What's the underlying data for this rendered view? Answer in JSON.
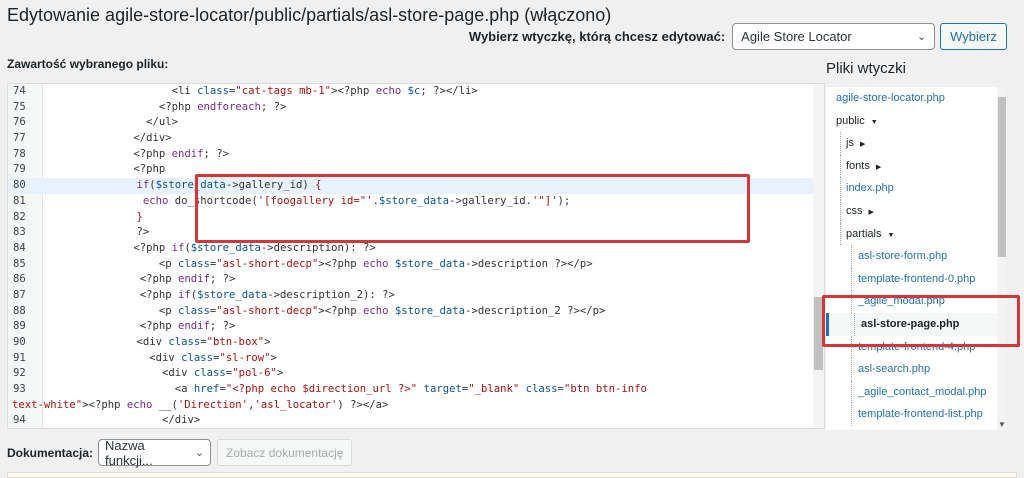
{
  "page": {
    "title": "Edytowanie agile-store-locator/public/partials/asl-store-page.php (włączono)",
    "content_label": "Zawartość wybranego pliku:"
  },
  "plugin_picker": {
    "label": "Wybierz wtyczkę, którą chcesz edytować:",
    "selected": "Agile Store Locator",
    "button": "Wybierz"
  },
  "editor": {
    "active_line": 80,
    "lines": [
      {
        "n": "74",
        "indent": 40,
        "segs": [
          [
            "p",
            "<li "
          ],
          [
            "a",
            "class"
          ],
          [
            "p",
            "="
          ],
          [
            "s",
            "\"cat-tags mb-1\""
          ],
          [
            "p",
            ">"
          ],
          [
            "p",
            "<?php "
          ],
          [
            "k",
            "echo"
          ],
          [
            "p",
            " "
          ],
          [
            "v",
            "$c"
          ],
          [
            "p",
            "; ?></li>"
          ]
        ]
      },
      {
        "n": "75",
        "indent": 36,
        "segs": [
          [
            "p",
            "<?php "
          ],
          [
            "k",
            "endforeach"
          ],
          [
            "p",
            "; ?>"
          ]
        ]
      },
      {
        "n": "76",
        "indent": 32,
        "segs": [
          [
            "p",
            "</ul>"
          ]
        ]
      },
      {
        "n": "77",
        "indent": 28,
        "segs": [
          [
            "p",
            "</div>"
          ]
        ]
      },
      {
        "n": "78",
        "indent": 28,
        "segs": [
          [
            "p",
            "<?php "
          ],
          [
            "k",
            "endif"
          ],
          [
            "p",
            "; ?>"
          ]
        ]
      },
      {
        "n": "79",
        "indent": 28,
        "segs": [
          [
            "p",
            "<?php"
          ]
        ]
      },
      {
        "n": "80",
        "indent": 29,
        "segs": [
          [
            "k",
            "if"
          ],
          [
            "p",
            "("
          ],
          [
            "v",
            "$store_data"
          ],
          [
            "p",
            "->gallery_id) "
          ],
          [
            "s",
            "{"
          ]
        ]
      },
      {
        "n": "81",
        "indent": 29,
        "segs": [
          [
            "p",
            " "
          ],
          [
            "k",
            "echo"
          ],
          [
            "p",
            " do_shortcode("
          ],
          [
            "s",
            "'[foogallery id=\"'"
          ],
          [
            "p",
            "."
          ],
          [
            "v",
            "$store_data"
          ],
          [
            "p",
            "->gallery_id."
          ],
          [
            "s",
            "'\"]'"
          ],
          [
            "p",
            ");"
          ]
        ]
      },
      {
        "n": "82",
        "indent": 29,
        "segs": [
          [
            "s",
            "}"
          ]
        ]
      },
      {
        "n": "83",
        "indent": 29,
        "segs": [
          [
            "p",
            "?>"
          ]
        ]
      },
      {
        "n": "84",
        "indent": 28,
        "segs": [
          [
            "p",
            "<?php "
          ],
          [
            "k",
            "if"
          ],
          [
            "p",
            "("
          ],
          [
            "v",
            "$store_data"
          ],
          [
            "p",
            "->description): ?>"
          ]
        ]
      },
      {
        "n": "85",
        "indent": 36,
        "segs": [
          [
            "p",
            "<p "
          ],
          [
            "a",
            "class"
          ],
          [
            "p",
            "="
          ],
          [
            "s",
            "\"asl-short-decp\""
          ],
          [
            "p",
            ">"
          ],
          [
            "p",
            "<?php "
          ],
          [
            "k",
            "echo"
          ],
          [
            "p",
            " "
          ],
          [
            "v",
            "$store_data"
          ],
          [
            "p",
            "->description ?></p>"
          ]
        ]
      },
      {
        "n": "86",
        "indent": 30,
        "segs": [
          [
            "p",
            "<?php "
          ],
          [
            "k",
            "endif"
          ],
          [
            "p",
            "; ?>"
          ]
        ]
      },
      {
        "n": "87",
        "indent": 30,
        "segs": [
          [
            "p",
            "<?php "
          ],
          [
            "k",
            "if"
          ],
          [
            "p",
            "("
          ],
          [
            "v",
            "$store_data"
          ],
          [
            "p",
            "->description_2): ?>"
          ]
        ]
      },
      {
        "n": "88",
        "indent": 36,
        "segs": [
          [
            "p",
            "<p "
          ],
          [
            "a",
            "class"
          ],
          [
            "p",
            "="
          ],
          [
            "s",
            "\"asl-short-decp\""
          ],
          [
            "p",
            ">"
          ],
          [
            "p",
            "<?php "
          ],
          [
            "k",
            "echo"
          ],
          [
            "p",
            " "
          ],
          [
            "v",
            "$store_data"
          ],
          [
            "p",
            "->description_2 ?></p>"
          ]
        ]
      },
      {
        "n": "89",
        "indent": 30,
        "segs": [
          [
            "p",
            "<?php "
          ],
          [
            "k",
            "endif"
          ],
          [
            "p",
            "; ?>"
          ]
        ]
      },
      {
        "n": "90",
        "indent": 29,
        "segs": [
          [
            "p",
            "<div "
          ],
          [
            "a",
            "class"
          ],
          [
            "p",
            "="
          ],
          [
            "s",
            "\"btn-box\""
          ],
          [
            "p",
            ">"
          ]
        ]
      },
      {
        "n": "91",
        "indent": 33,
        "segs": [
          [
            "p",
            "<div "
          ],
          [
            "a",
            "class"
          ],
          [
            "p",
            "="
          ],
          [
            "s",
            "\"sl-row\""
          ],
          [
            "p",
            ">"
          ]
        ]
      },
      {
        "n": "92",
        "indent": 37,
        "segs": [
          [
            "p",
            "<div "
          ],
          [
            "a",
            "class"
          ],
          [
            "p",
            "="
          ],
          [
            "s",
            "\"pol-6\""
          ],
          [
            "p",
            ">"
          ]
        ]
      },
      {
        "n": "93",
        "indent": 41,
        "segs": [
          [
            "p",
            "<a "
          ],
          [
            "a",
            "href"
          ],
          [
            "p",
            "="
          ],
          [
            "s",
            "\"<?php echo $direction_url ?>\""
          ],
          [
            "p",
            " "
          ],
          [
            "a",
            "target"
          ],
          [
            "p",
            "="
          ],
          [
            "s",
            "\"_blank\""
          ],
          [
            "p",
            " "
          ],
          [
            "a",
            "class"
          ],
          [
            "p",
            "="
          ],
          [
            "s",
            "\"btn btn-info"
          ]
        ]
      },
      {
        "n": "",
        "indent": 0,
        "segs": [
          [
            "s",
            "text-white\""
          ],
          [
            "p",
            ">"
          ],
          [
            "p",
            "<?php "
          ],
          [
            "k",
            "echo"
          ],
          [
            "p",
            " __("
          ],
          [
            "s",
            "'Direction'"
          ],
          [
            "p",
            ","
          ],
          [
            "s",
            "'asl_locator'"
          ],
          [
            "p",
            ") ?></a>"
          ]
        ]
      },
      {
        "n": "94",
        "indent": 37,
        "segs": [
          [
            "p",
            "</div>"
          ]
        ]
      }
    ]
  },
  "files": {
    "title": "Pliki wtyczki",
    "items": [
      {
        "label": "agile-store-locator.php",
        "level": 0,
        "type": "file"
      },
      {
        "label": "public",
        "level": 0,
        "type": "dir",
        "caret": "▼"
      },
      {
        "label": "js",
        "level": 1,
        "type": "dir",
        "caret": "▶"
      },
      {
        "label": "fonts",
        "level": 1,
        "type": "dir",
        "caret": "▶"
      },
      {
        "label": "index.php",
        "level": 1,
        "type": "file"
      },
      {
        "label": "css",
        "level": 1,
        "type": "dir",
        "caret": "▶"
      },
      {
        "label": "partials",
        "level": 1,
        "type": "dir",
        "caret": "▼"
      },
      {
        "label": "asl-store-form.php",
        "level": 2,
        "type": "file"
      },
      {
        "label": "template-frontend-0.php",
        "level": 2,
        "type": "file"
      },
      {
        "label": "_agile_modal.php",
        "level": 2,
        "type": "file"
      },
      {
        "label": "asl-store-page.php",
        "level": 2,
        "type": "current"
      },
      {
        "label": "template-frontend-4.php",
        "level": 2,
        "type": "file"
      },
      {
        "label": "asl-search.php",
        "level": 2,
        "type": "file"
      },
      {
        "label": "_agile_contact_modal.php",
        "level": 2,
        "type": "file"
      },
      {
        "label": "template-frontend-list.php",
        "level": 2,
        "type": "file"
      }
    ]
  },
  "documentation": {
    "label": "Dokumentacja:",
    "select": "Nazwa funkcji...",
    "button": "Zobacz dokumentację"
  },
  "colors": {
    "accent": "#2271b1",
    "highlight_border": "#d63638"
  },
  "icons": {
    "select_chevron": "chevron-down-icon",
    "dir_expanded": "caret-down-icon",
    "dir_collapsed": "caret-right-icon"
  }
}
